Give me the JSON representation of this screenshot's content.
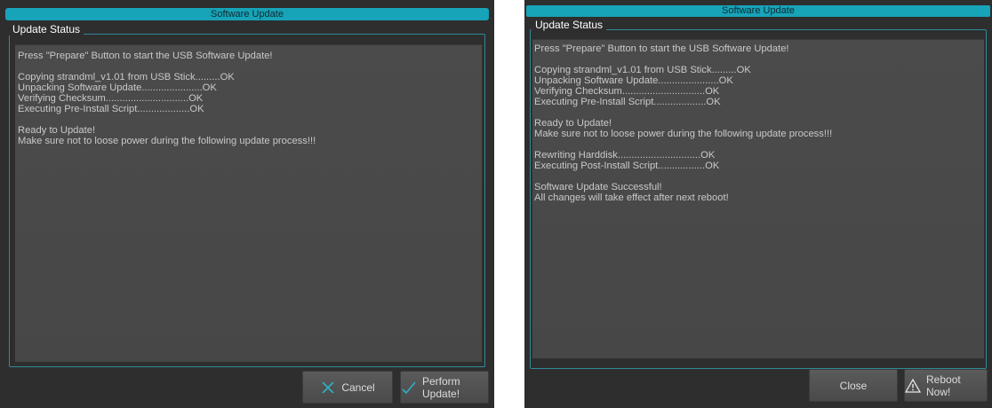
{
  "panels": [
    {
      "title": "Software Update",
      "group_label": "Update Status",
      "log_lines": [
        "Press \"Prepare\" Button to start the USB Software Update!",
        "",
        "Copying strandml_v1.01 from USB Stick.........OK",
        "Unpacking Software Update......................OK",
        "Verifying Checksum..............................OK",
        "Executing Pre-Install Script...................OK",
        "",
        "Ready to Update!",
        "Make sure not to loose power during the following update process!!!"
      ],
      "buttons": {
        "cancel": {
          "label": "Cancel",
          "icon": "x-icon",
          "color": "#2fb1c7"
        },
        "perform": {
          "label": "Perform Update!",
          "icon": "checkmark-icon",
          "color": "#2fb1c7"
        }
      }
    },
    {
      "title": "Software Update",
      "group_label": "Update Status",
      "log_lines": [
        "Press \"Prepare\" Button to start the USB Software Update!",
        "",
        "Copying strandml_v1.01 from USB Stick.........OK",
        "Unpacking Software Update......................OK",
        "Verifying Checksum..............................OK",
        "Executing Pre-Install Script...................OK",
        "",
        "Ready to Update!",
        "Make sure not to loose power during the following update process!!!",
        "",
        "Rewriting Harddisk..............................OK",
        "Executing Post-Install Script.................OK",
        "",
        "Software Update Successful!",
        "All changes will take effect after next reboot!"
      ],
      "buttons": {
        "close": {
          "label": "Close"
        },
        "reboot": {
          "label": "Reboot Now!",
          "icon": "warning-icon"
        }
      }
    }
  ],
  "colors": {
    "accent": "#17a3b8",
    "dialog_bg": "#2e2e2e",
    "log_bg": "#4a4a4a",
    "log_text": "#c9c9c9"
  }
}
